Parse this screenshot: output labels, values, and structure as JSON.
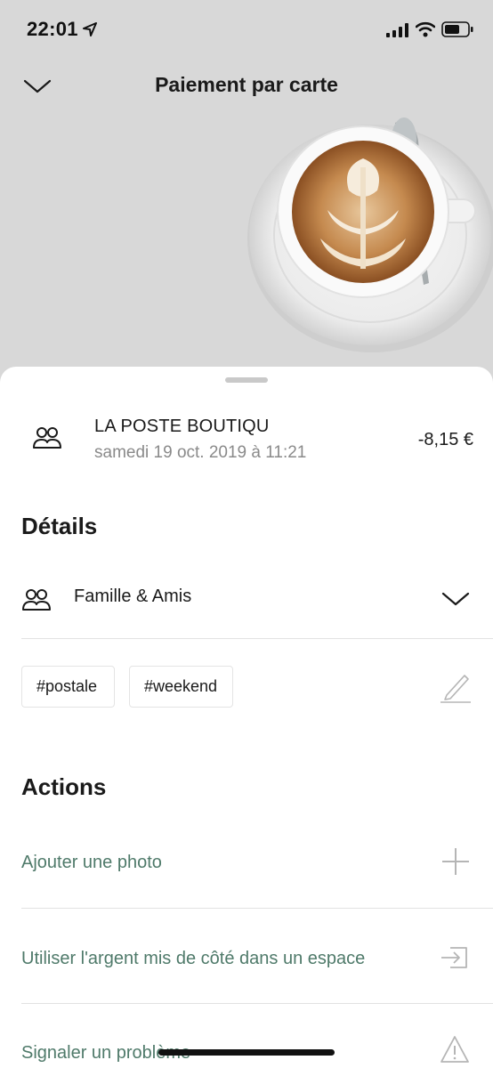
{
  "status_bar": {
    "time": "22:01"
  },
  "header": {
    "title": "Paiement par carte"
  },
  "transaction": {
    "merchant": "LA POSTE BOUTIQU",
    "date": "samedi 19 oct. 2019 à 11:21",
    "amount": "-8,15 €"
  },
  "details": {
    "title": "Détails",
    "category": "Famille & Amis",
    "tags": [
      "#postale",
      "#weekend"
    ]
  },
  "actions": {
    "title": "Actions",
    "items": [
      {
        "label": "Ajouter une photo",
        "icon": "plus-icon"
      },
      {
        "label": "Utiliser l'argent mis de côté dans un espace",
        "icon": "transfer-icon"
      },
      {
        "label": "Signaler un problème",
        "icon": "warning-icon"
      }
    ]
  },
  "colors": {
    "action_text": "#4f7a6a",
    "sheet_bg": "#ffffff",
    "hero_bg": "#d8d8d8"
  }
}
